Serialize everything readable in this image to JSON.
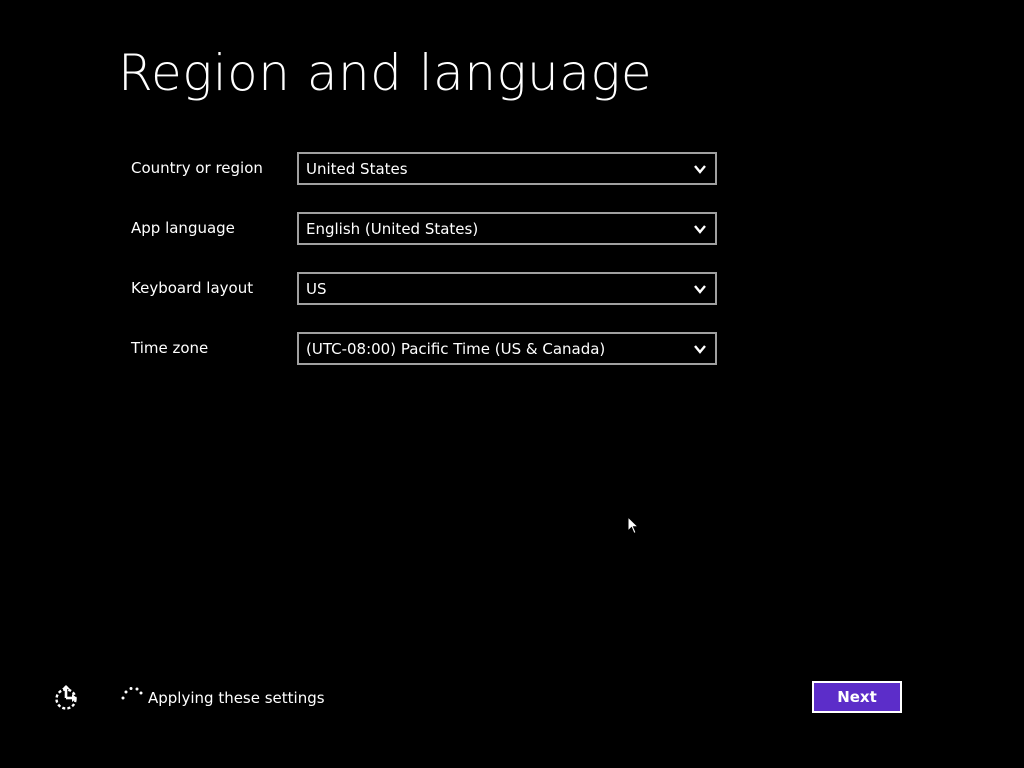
{
  "page": {
    "title": "Region and language"
  },
  "settings": [
    {
      "label": "Country or region",
      "value": "United States"
    },
    {
      "label": "App language",
      "value": "English (United States)"
    },
    {
      "label": "Keyboard layout",
      "value": "US"
    },
    {
      "label": "Time zone",
      "value": "(UTC-08:00) Pacific Time (US & Canada)"
    }
  ],
  "footer": {
    "status_text": "Applying these settings",
    "next_label": "Next",
    "ease_of_access_icon": "ease-of-access-icon",
    "spinner_icon": "progress-spinner-icon"
  },
  "colors": {
    "background": "#000000",
    "text": "#ffffff",
    "accent": "#5c2dc9",
    "field_border": "#a0a0a0"
  }
}
